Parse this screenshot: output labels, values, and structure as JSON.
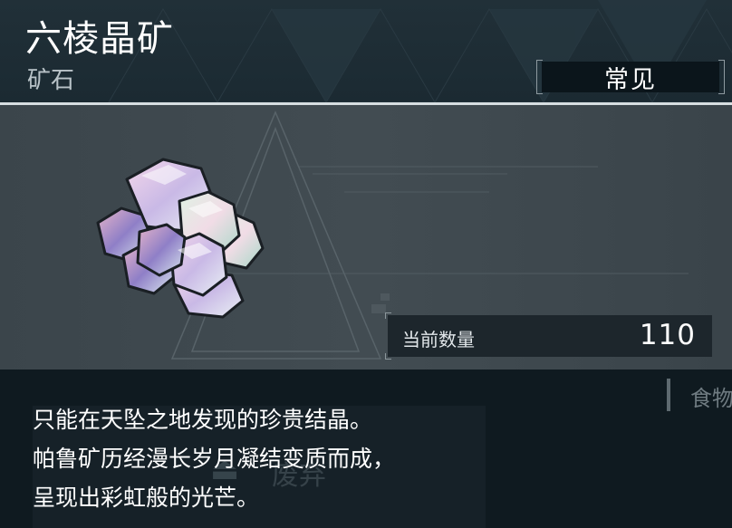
{
  "item": {
    "name": "六棱晶矿",
    "category": "矿石",
    "rarity": "常见",
    "count_label": "当前数量",
    "count": "110"
  },
  "description": {
    "lines": [
      "只能在天坠之地发现的珍贵结晶。",
      "帕鲁矿历经漫长岁月凝结变质而成，",
      "呈现出彩虹般的光芒。"
    ]
  },
  "background": {
    "side_tab": "食物",
    "faded_button": "废弃"
  },
  "colors": {
    "header_bg": "#1e2d35",
    "panel_bg": "#3f494f",
    "count_box_bg": "#1d262c",
    "page_bg": "#0f1a20"
  }
}
